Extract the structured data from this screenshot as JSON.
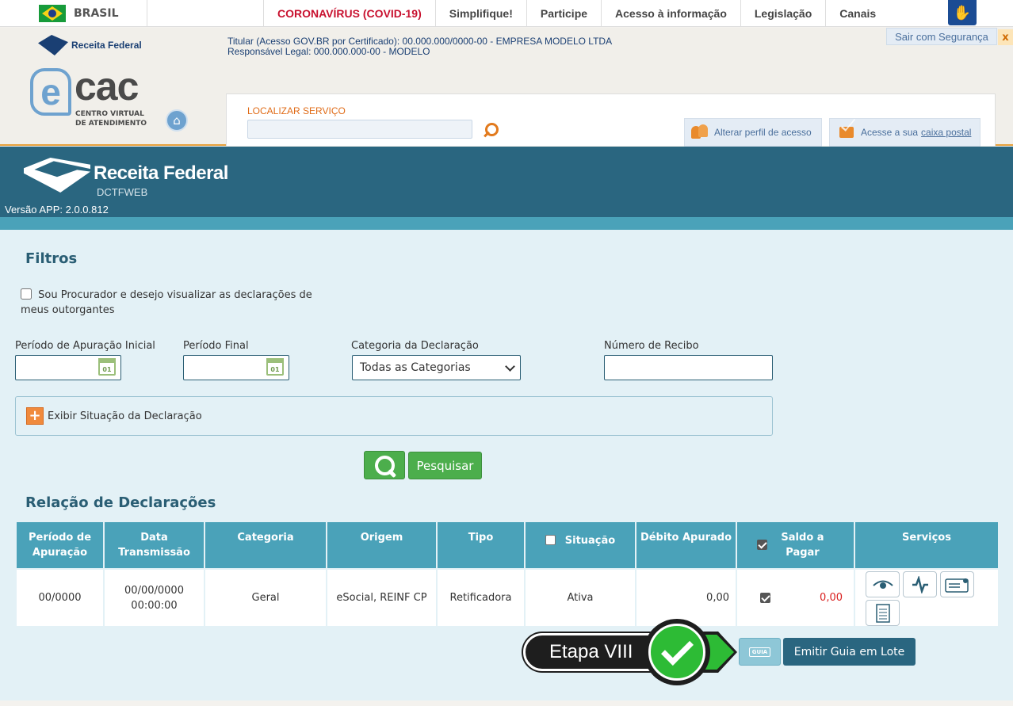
{
  "govbar": {
    "country": "BRASIL",
    "links": [
      "CORONAVÍRUS (COVID-19)",
      "Simplifique!",
      "Participe",
      "Acesso à informação",
      "Legislação",
      "Canais"
    ]
  },
  "ecac": {
    "rf_name": "Receita Federal",
    "logo_cac": "cac",
    "logo_sub": "CENTRO VIRTUAL\nDE ATENDIMENTO",
    "titular_line1": "Titular (Acesso GOV.BR por Certificado): 00.000.000/0000-00 - EMPRESA MODELO LTDA",
    "titular_line2": "Responsável Legal: 000.000.000-00 - MODELO",
    "sair": "Sair com Segurança",
    "sair_close": "x",
    "localizar_label": "LOCALIZAR SERVIÇO",
    "perfil": "Alterar perfil de acesso",
    "caixa_prefix": "Acesse a sua",
    "caixa_link": "caixa postal"
  },
  "banner": {
    "title": "Receita Federal",
    "subtitle": "DCTFWEB",
    "versao": "Versão APP: 2.0.0.812"
  },
  "filtros": {
    "heading": "Filtros",
    "procurador": "Sou Procurador e desejo visualizar as declarações de meus outorgantes",
    "periodo_inicial_label": "Período de Apuração Inicial",
    "periodo_final_label": "Período Final",
    "categoria_label": "Categoria da Declaração",
    "categoria_value": "Todas as Categorias",
    "recibo_label": "Número de Recibo",
    "exibir": "Exibir Situação da Declaração",
    "pesquisar": "Pesquisar",
    "cal_text": "01"
  },
  "relacao": {
    "heading": "Relação de Declarações",
    "headers": [
      "Período de Apuração",
      "Data Transmissão",
      "Categoria",
      "Origem",
      "Tipo",
      "Situação",
      "Débito Apurado",
      "Saldo a Pagar",
      "Serviços"
    ],
    "row": {
      "periodo": "00/0000",
      "data": "00/00/0000",
      "hora": "00:00:00",
      "categoria": "Geral",
      "origem": "eSocial, REINF CP",
      "tipo": "Retificadora",
      "situacao": "Ativa",
      "debito": "0,00",
      "saldo": "0,00"
    },
    "saldo_color": "#d9201f"
  },
  "bottom": {
    "guia_icon_text": "GUIA",
    "emitir": "Emitir Guia em Lote",
    "etapa": "Etapa VIII"
  }
}
